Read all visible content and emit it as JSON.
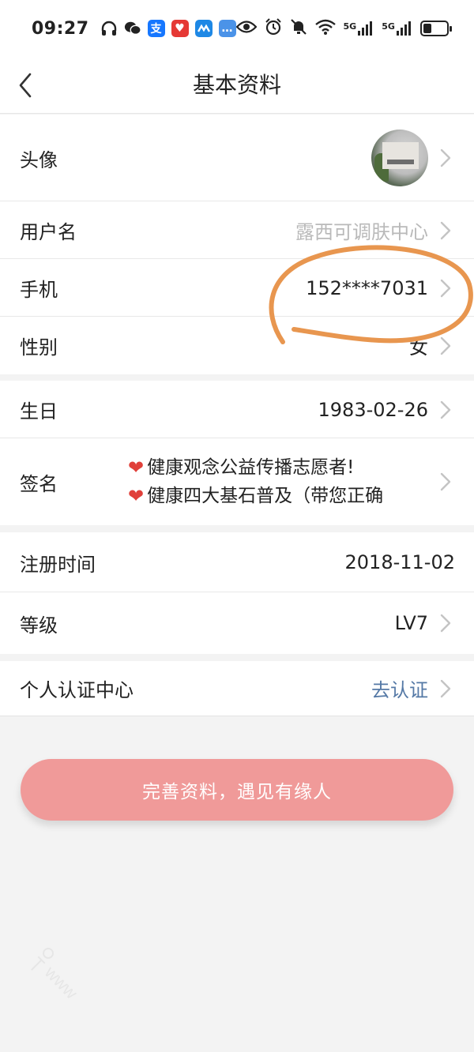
{
  "status_bar": {
    "time": "09:27",
    "app_icons": [
      {
        "name": "headphones-icon",
        "glyph": "∩",
        "color": "#222222"
      },
      {
        "name": "wechat-icon",
        "glyph": "●",
        "color": "#222222"
      },
      {
        "name": "alipay-icon",
        "glyph": "支",
        "color": "#1677ff"
      },
      {
        "name": "red-heart-app-icon",
        "glyph": "♥",
        "color": "#e53935"
      },
      {
        "name": "blue-app-icon",
        "glyph": "∿",
        "color": "#1e88e5"
      },
      {
        "name": "message-bubble-icon",
        "glyph": "…",
        "color": "#3a8ee6"
      }
    ],
    "network": [
      "5G",
      "5G"
    ],
    "battery_level": 0.35
  },
  "header": {
    "title": "基本资料",
    "back_icon": "chevron-left-icon"
  },
  "profile": {
    "avatar": {
      "label": "头像"
    },
    "username": {
      "label": "用户名",
      "value": "露西可调肤中心"
    },
    "phone": {
      "label": "手机",
      "value": "152****7031"
    },
    "gender": {
      "label": "性别",
      "value": "女"
    },
    "birthday": {
      "label": "生日",
      "value": "1983-02-26"
    },
    "signature": {
      "label": "签名",
      "lines": [
        "健康观念公益传播志愿者!",
        "健康四大基石普及（带您正确"
      ]
    },
    "registered": {
      "label": "注册时间",
      "value": "2018-11-02"
    },
    "level": {
      "label": "等级",
      "value": "LV7"
    },
    "verification": {
      "label": "个人认证中心",
      "value": "去认证"
    }
  },
  "cta": {
    "label": "完善资料，遇见有缘人"
  },
  "colors": {
    "cta_bg": "#f09a99",
    "link_blue": "#5579a6",
    "annotation_orange": "#e8964f"
  }
}
